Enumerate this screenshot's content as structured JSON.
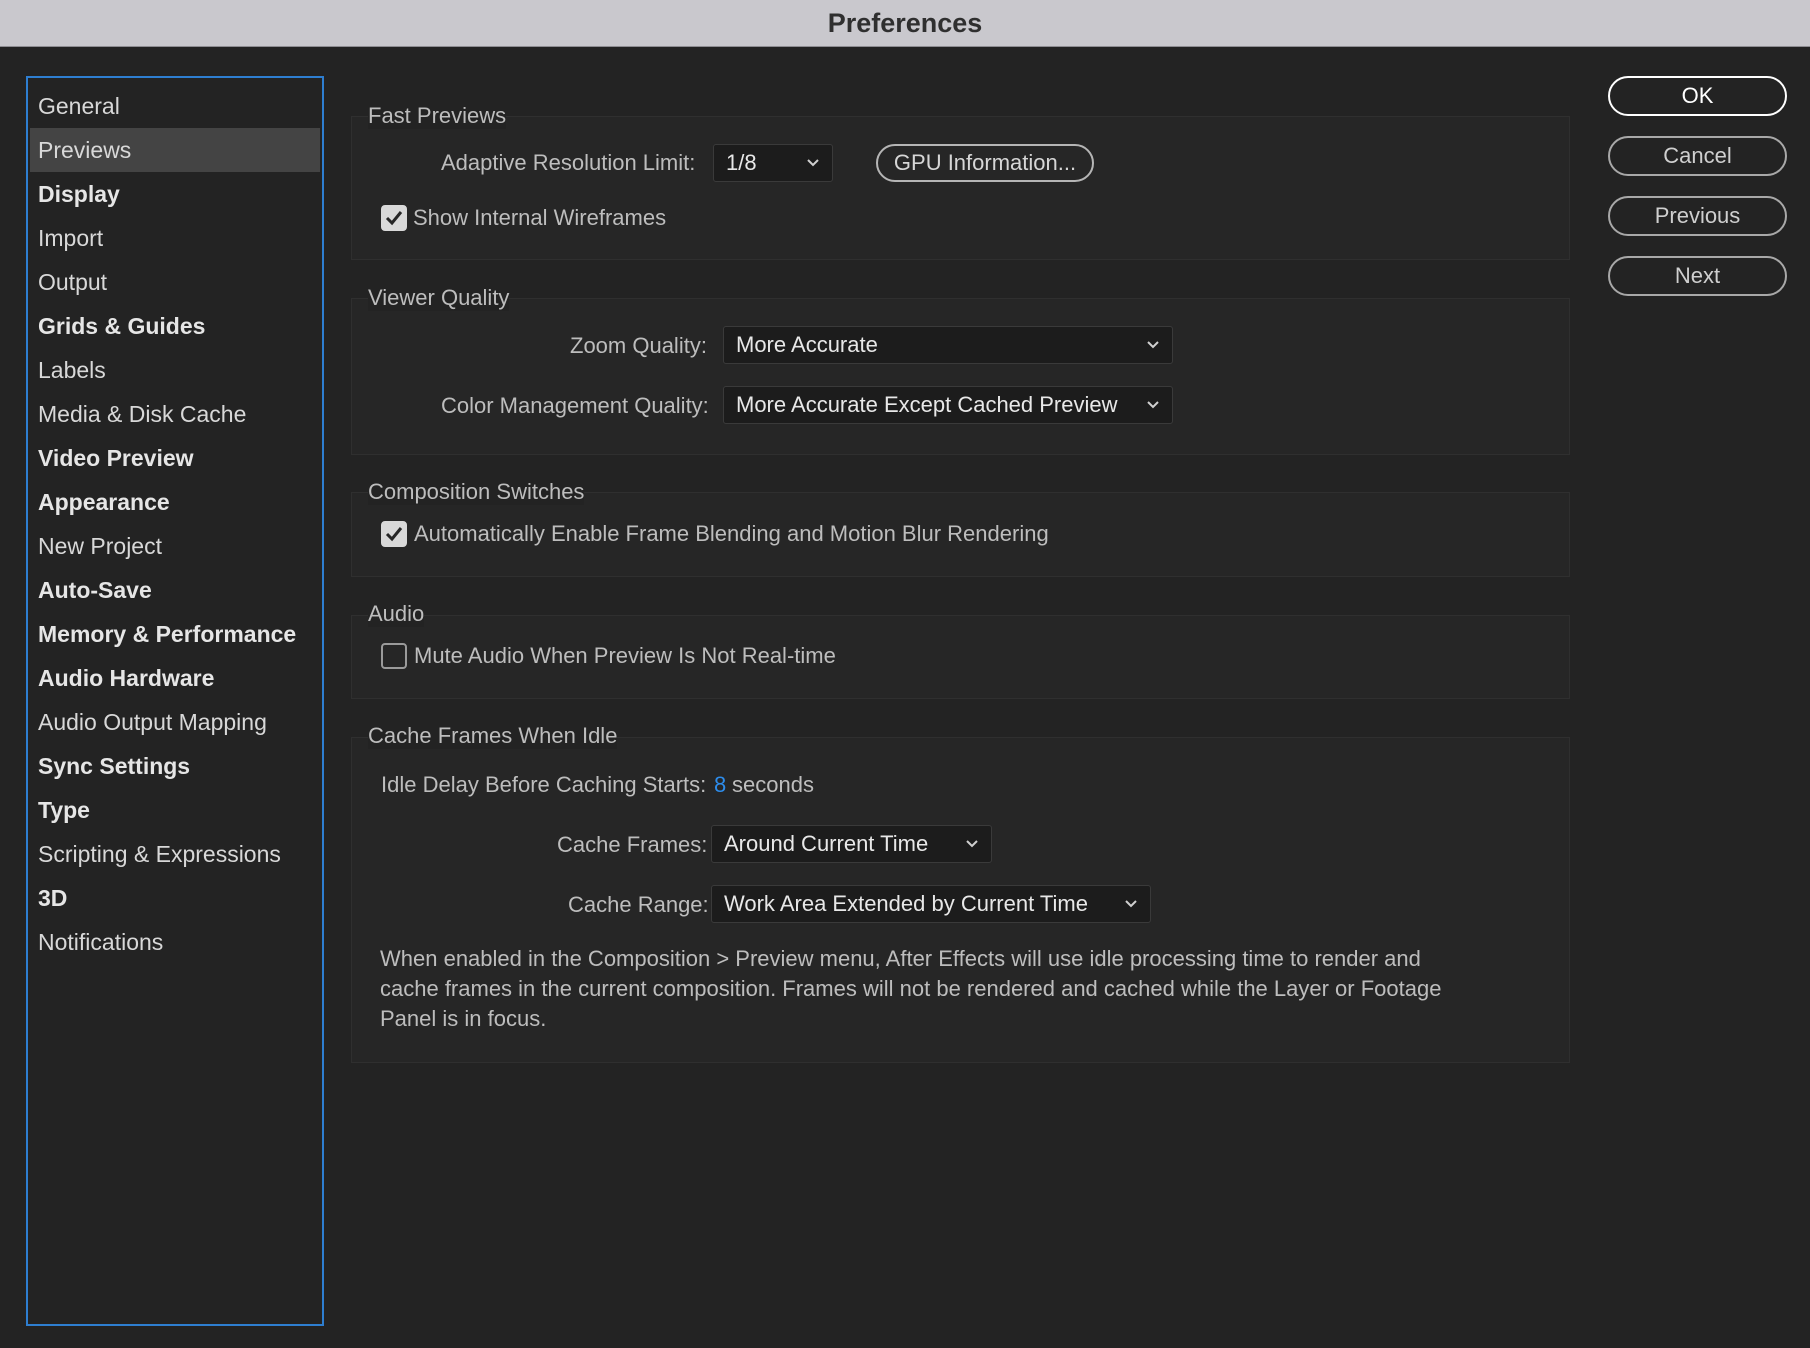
{
  "window": {
    "title": "Preferences"
  },
  "sidebar": {
    "items": [
      {
        "label": "General",
        "bold": false,
        "selected": false
      },
      {
        "label": "Previews",
        "bold": false,
        "selected": true
      },
      {
        "label": "Display",
        "bold": true,
        "selected": false
      },
      {
        "label": "Import",
        "bold": false,
        "selected": false
      },
      {
        "label": "Output",
        "bold": false,
        "selected": false
      },
      {
        "label": "Grids & Guides",
        "bold": true,
        "selected": false
      },
      {
        "label": "Labels",
        "bold": false,
        "selected": false
      },
      {
        "label": "Media & Disk Cache",
        "bold": false,
        "selected": false
      },
      {
        "label": "Video Preview",
        "bold": true,
        "selected": false
      },
      {
        "label": "Appearance",
        "bold": true,
        "selected": false
      },
      {
        "label": "New Project",
        "bold": false,
        "selected": false
      },
      {
        "label": "Auto-Save",
        "bold": true,
        "selected": false
      },
      {
        "label": "Memory & Performance",
        "bold": true,
        "selected": false
      },
      {
        "label": "Audio Hardware",
        "bold": true,
        "selected": false
      },
      {
        "label": "Audio Output Mapping",
        "bold": false,
        "selected": false
      },
      {
        "label": "Sync Settings",
        "bold": true,
        "selected": false
      },
      {
        "label": "Type",
        "bold": true,
        "selected": false
      },
      {
        "label": "Scripting & Expressions",
        "bold": false,
        "selected": false
      },
      {
        "label": "3D",
        "bold": true,
        "selected": false
      },
      {
        "label": "Notifications",
        "bold": false,
        "selected": false
      }
    ]
  },
  "fast_previews": {
    "title": "Fast Previews",
    "adaptive_label": "Adaptive Resolution Limit:",
    "adaptive_value": "1/8",
    "gpu_button": "GPU Information...",
    "wireframes_label": "Show Internal Wireframes",
    "wireframes_checked": true
  },
  "viewer_quality": {
    "title": "Viewer Quality",
    "zoom_label": "Zoom Quality:",
    "zoom_value": "More Accurate",
    "color_label": "Color Management Quality:",
    "color_value": "More Accurate Except Cached Preview"
  },
  "composition_switches": {
    "title": "Composition Switches",
    "auto_label": "Automatically Enable Frame Blending and Motion Blur Rendering",
    "auto_checked": true
  },
  "audio": {
    "title": "Audio",
    "mute_label": "Mute Audio When Preview Is Not Real-time",
    "mute_checked": false
  },
  "cache_idle": {
    "title": "Cache Frames When Idle",
    "idle_label": "Idle Delay Before Caching Starts:",
    "idle_value": "8",
    "idle_unit": "seconds",
    "frames_label": "Cache Frames:",
    "frames_value": "Around Current Time",
    "range_label": "Cache Range:",
    "range_value": "Work Area Extended by Current Time",
    "description": "When enabled in the Composition > Preview menu, After Effects will use idle processing time to render and cache frames in the current composition. Frames will not be rendered and cached while the Layer or Footage Panel is in focus."
  },
  "buttons": {
    "ok": "OK",
    "cancel": "Cancel",
    "previous": "Previous",
    "next": "Next"
  },
  "colors": {
    "accent": "#2d8ceb",
    "sidebar_border": "#2e7ed0",
    "background": "#232323"
  }
}
